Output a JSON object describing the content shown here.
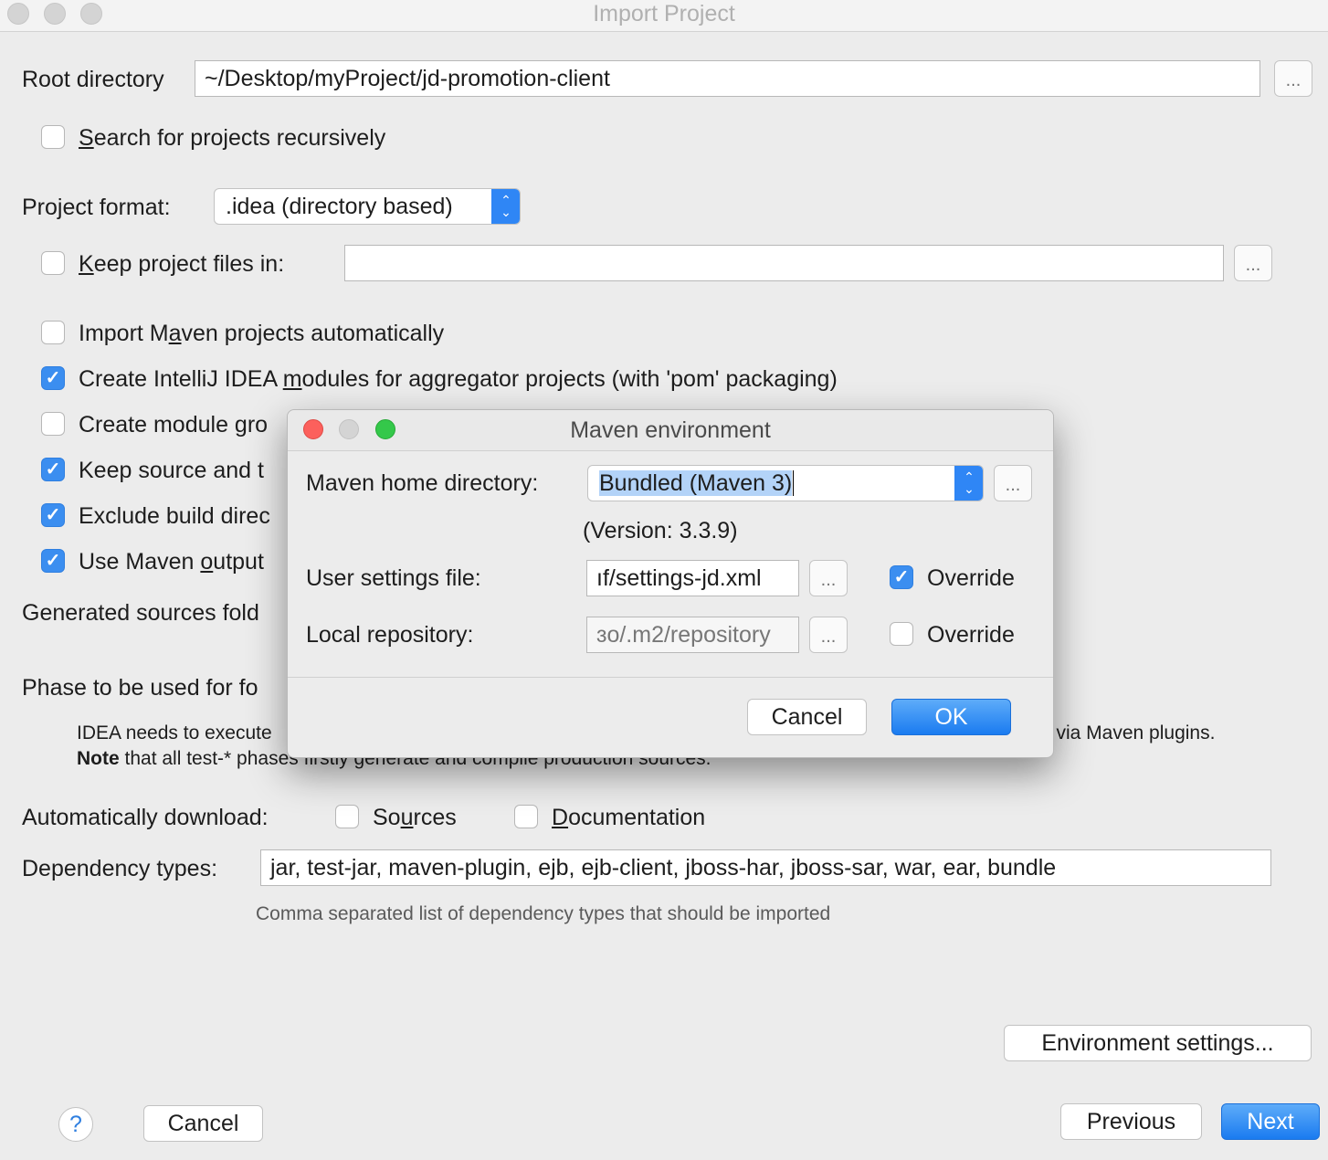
{
  "window": {
    "title": "Import Project"
  },
  "root_directory": {
    "label": "Root directory",
    "value": "~/Desktop/myProject/jd-promotion-client",
    "browse": "..."
  },
  "search_recursive": {
    "pre": "",
    "mnemonic": "S",
    "post": "earch for projects recursively",
    "checked": false
  },
  "project_format": {
    "label": "Project format:",
    "value": ".idea (directory based)"
  },
  "keep_project_files": {
    "pre": "",
    "mnemonic": "K",
    "post": "eep project files in:",
    "checked": false,
    "value": "",
    "browse": "..."
  },
  "options": [
    {
      "pre": "Import M",
      "mnemonic": "a",
      "post": "ven projects automatically",
      "checked": false
    },
    {
      "pre": "Create IntelliJ IDEA ",
      "mnemonic": "m",
      "post": "odules for aggregator projects (with 'pom' packaging)",
      "checked": true
    },
    {
      "pre": "Create module gro",
      "mnemonic": "",
      "post": "",
      "checked": false
    },
    {
      "pre": "Keep source and t",
      "mnemonic": "",
      "post": "",
      "checked": true
    },
    {
      "pre": "Exclude build direc",
      "mnemonic": "",
      "post": "",
      "checked": true
    },
    {
      "pre": "Use Maven ",
      "mnemonic": "o",
      "post": "utput",
      "checked": true
    }
  ],
  "generated_sources": {
    "label": "Generated sources fold"
  },
  "phase": {
    "label": "Phase to be used for fo",
    "note_line1_left": "IDEA needs to execute",
    "note_line1_right": "l via Maven plugins.",
    "note_bold": "Note",
    "note_line2": " that all test-* phases firstly generate and compile production sources."
  },
  "auto_download": {
    "label": "Automatically download:",
    "sources": {
      "pre": "So",
      "mnemonic": "u",
      "post": "rces",
      "checked": false
    },
    "documentation": {
      "pre": "",
      "mnemonic": "D",
      "post": "ocumentation",
      "checked": false
    }
  },
  "dependency_types": {
    "label": "Dependency types:",
    "value": "jar, test-jar, maven-plugin, ejb, ejb-client, jboss-har, jboss-sar, war, ear, bundle",
    "hint": "Comma separated list of dependency types that should be imported"
  },
  "buttons": {
    "environment": "Environment settings...",
    "help": "?",
    "cancel": "Cancel",
    "previous": "Previous",
    "next": "Next"
  },
  "dialog": {
    "title": "Maven environment",
    "maven_home": {
      "label": "Maven home directory:",
      "value": "Bundled (Maven 3)",
      "browse": "..."
    },
    "version": "(Version: 3.3.9)",
    "user_settings": {
      "label": "User settings file:",
      "value": "ıf/settings-jd.xml",
      "browse": "...",
      "override_label": "Override",
      "override_checked": true
    },
    "local_repo": {
      "label": "Local repository:",
      "value": "ɜo/.m2/repository",
      "browse": "...",
      "override_label": "Override",
      "override_checked": false
    },
    "cancel": "Cancel",
    "ok": "OK"
  },
  "colors": {
    "accent": "#2f86f5",
    "window_bg": "#ececec",
    "close": "#fc605c",
    "zoom": "#34c84a"
  }
}
